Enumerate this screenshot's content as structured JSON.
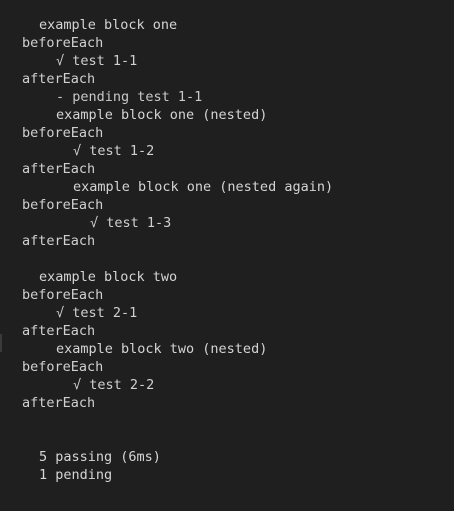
{
  "terminal": {
    "lines": [
      {
        "text": "example block one",
        "kind": "suite",
        "indent": 1
      },
      {
        "text": "beforeEach",
        "kind": "hook",
        "indent": 0
      },
      {
        "text": "√ test 1-1",
        "kind": "pass",
        "indent": 2
      },
      {
        "text": "afterEach",
        "kind": "hook",
        "indent": 0
      },
      {
        "text": "- pending test 1-1",
        "kind": "pending",
        "indent": 2
      },
      {
        "text": "example block one (nested)",
        "kind": "suite",
        "indent": 2
      },
      {
        "text": "beforeEach",
        "kind": "hook",
        "indent": 0
      },
      {
        "text": "√ test 1-2",
        "kind": "pass",
        "indent": 3
      },
      {
        "text": "afterEach",
        "kind": "hook",
        "indent": 0
      },
      {
        "text": "example block one (nested again)",
        "kind": "suite",
        "indent": 3
      },
      {
        "text": "beforeEach",
        "kind": "hook",
        "indent": 0
      },
      {
        "text": "√ test 1-3",
        "kind": "pass",
        "indent": 4
      },
      {
        "text": "afterEach",
        "kind": "hook",
        "indent": 0
      },
      {
        "text": "",
        "kind": "blank",
        "indent": 0
      },
      {
        "text": "example block two",
        "kind": "suite",
        "indent": 1
      },
      {
        "text": "beforeEach",
        "kind": "hook",
        "indent": 0
      },
      {
        "text": "√ test 2-1",
        "kind": "pass",
        "indent": 2
      },
      {
        "text": "afterEach",
        "kind": "hook",
        "indent": 0
      },
      {
        "text": "example block two (nested)",
        "kind": "suite",
        "indent": 2
      },
      {
        "text": "beforeEach",
        "kind": "hook",
        "indent": 0
      },
      {
        "text": "√ test 2-2",
        "kind": "pass",
        "indent": 3
      },
      {
        "text": "afterEach",
        "kind": "hook",
        "indent": 0
      },
      {
        "text": "",
        "kind": "blank",
        "indent": 0
      },
      {
        "text": "",
        "kind": "blank",
        "indent": 0
      },
      {
        "text": "5 passing (6ms)",
        "kind": "summary",
        "indent": 1
      },
      {
        "text": "1 pending",
        "kind": "summary",
        "indent": 1
      }
    ]
  },
  "colors": {
    "background": "#1f1f1f",
    "text": "#d2d2d2"
  }
}
